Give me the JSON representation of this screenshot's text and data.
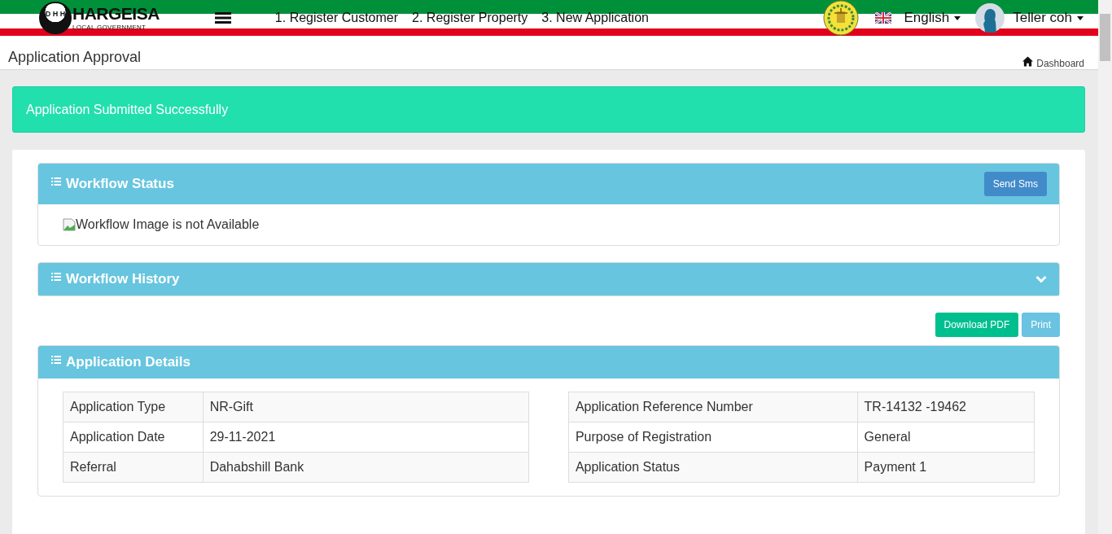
{
  "header": {
    "logo": {
      "mark": "D H H",
      "title": "HARGEISA",
      "subtitle": "LOCAL GOVERNMENT"
    },
    "nav": [
      "1. Register Customer",
      "2. Register Property",
      "3. New Application"
    ],
    "language": "English",
    "user": "Teller coh"
  },
  "page": {
    "title": "Application Approval",
    "breadcrumb": "Dashboard"
  },
  "alert": {
    "text": "Application Submitted Successfully"
  },
  "workflow_status": {
    "title": "Workflow Status",
    "button": "Send Sms",
    "image_alt": "Workflow Image is not Available"
  },
  "workflow_history": {
    "title": "Workflow History",
    "expanded": false
  },
  "actions": [
    {
      "label": "Download PDF",
      "kind": "success"
    },
    {
      "label": "Print",
      "kind": "info"
    }
  ],
  "application_details": {
    "title": "Application Details",
    "tables": [
      [
        {
          "label": "Application Type",
          "value": "NR-Gift"
        },
        {
          "label": "Application Date",
          "value": "29-11-2021"
        },
        {
          "label": "Referral",
          "value": "Dahabshill Bank"
        }
      ],
      [
        {
          "label": "Application Reference Number",
          "value": "TR-14132 -19462"
        },
        {
          "label": "Purpose of Registration",
          "value": "General"
        },
        {
          "label": "Application Status",
          "value": "Payment 1"
        }
      ]
    ]
  }
}
